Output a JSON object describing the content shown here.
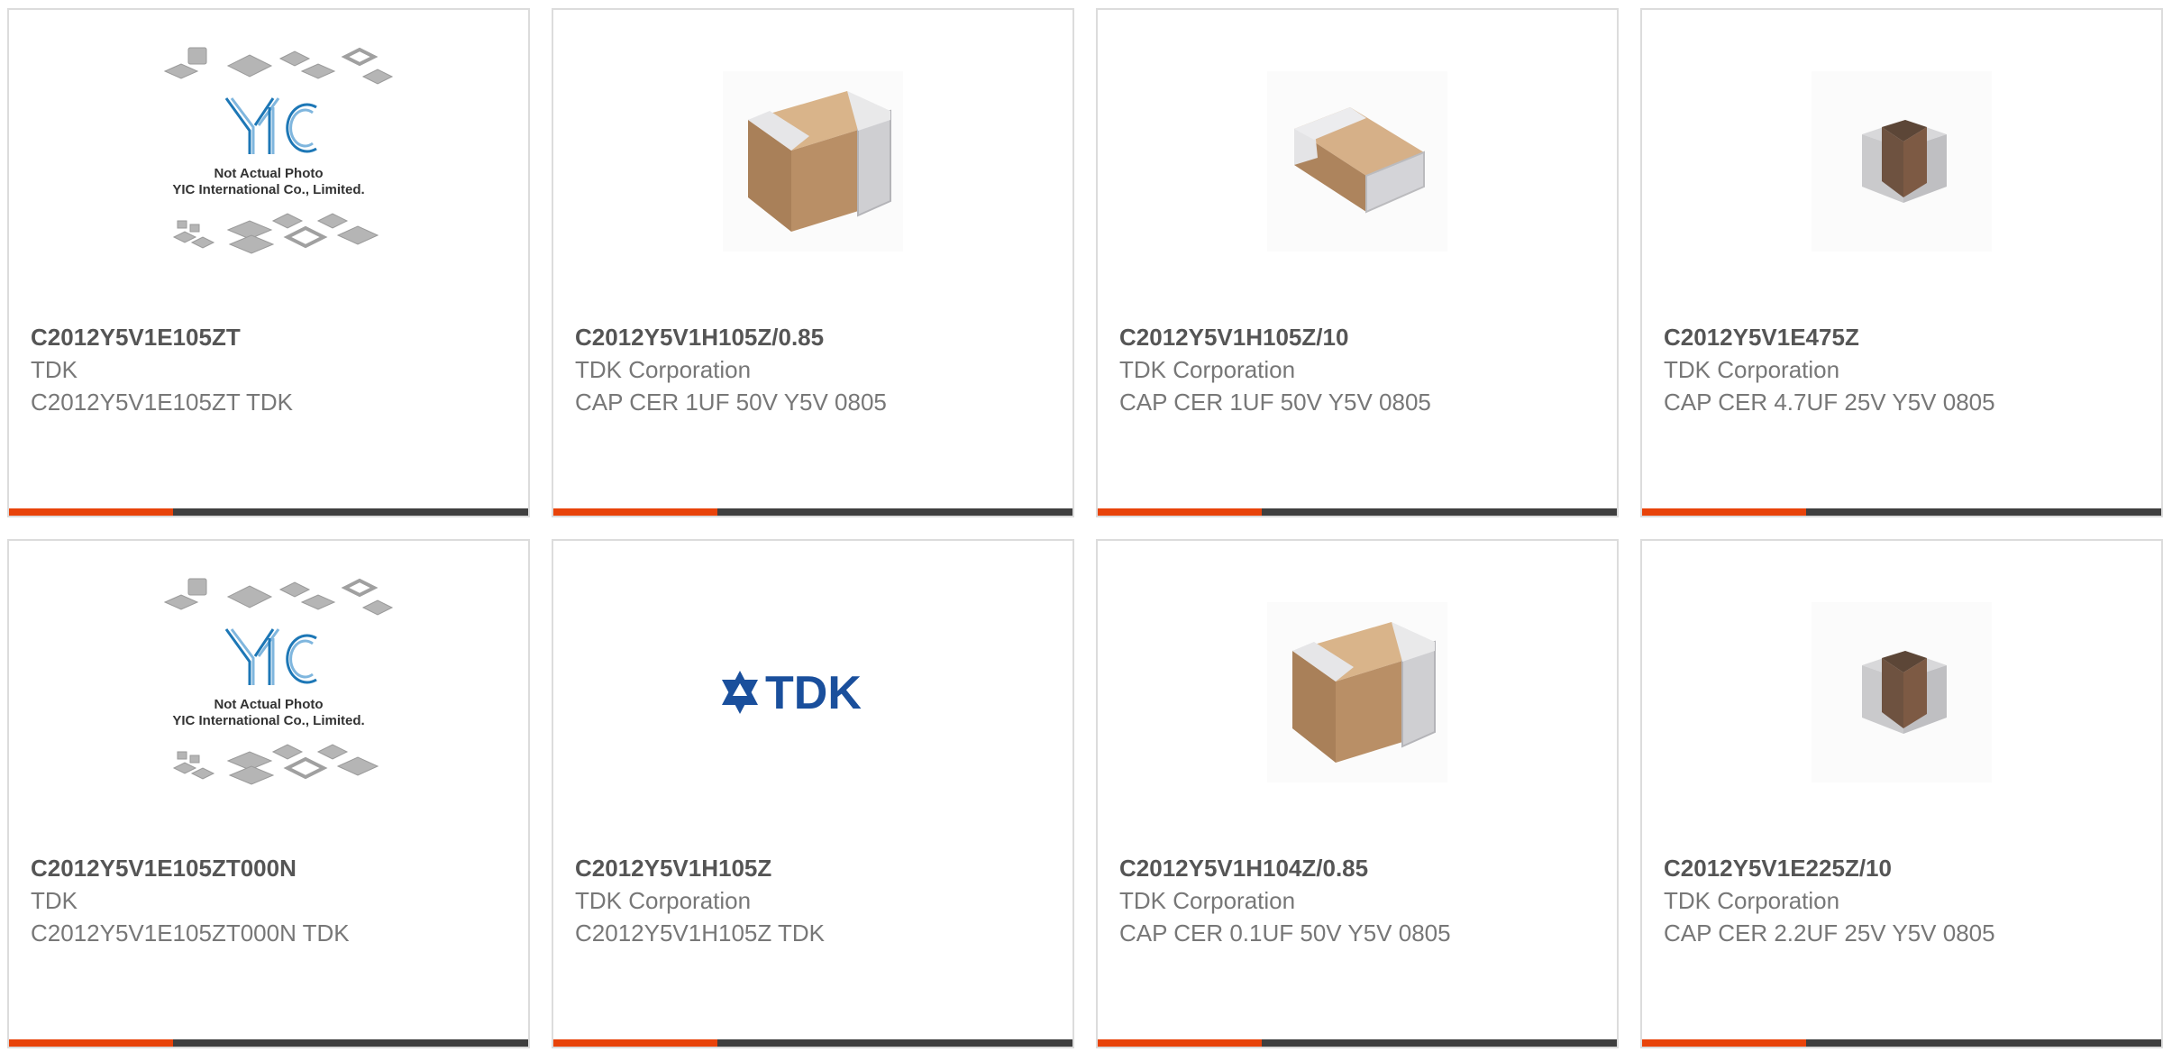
{
  "colors": {
    "accent": "#e8430a",
    "bar_dark": "#3f3f3f",
    "border": "#dcdcdc",
    "tdk_blue": "#1a4f9c",
    "yic_blue": "#1d77b6"
  },
  "products": [
    {
      "part_number": "C2012Y5V1E105ZT",
      "manufacturer": "TDK",
      "description": "C2012Y5V1E105ZT TDK",
      "image": "yic-placeholder",
      "image_text": [
        "Not Actual Photo",
        "YIC International Co., Limited."
      ]
    },
    {
      "part_number": "C2012Y5V1H105Z/0.85",
      "manufacturer": "TDK Corporation",
      "description": "CAP CER 1UF 50V Y5V 0805",
      "image": "chip-capacitor-large"
    },
    {
      "part_number": "C2012Y5V1H105Z/10",
      "manufacturer": "TDK Corporation",
      "description": "CAP CER 1UF 50V Y5V 0805",
      "image": "chip-capacitor-medium"
    },
    {
      "part_number": "C2012Y5V1E475Z",
      "manufacturer": "TDK Corporation",
      "description": "CAP CER 4.7UF 25V Y5V 0805",
      "image": "chip-capacitor-small"
    },
    {
      "part_number": "C2012Y5V1E105ZT000N",
      "manufacturer": "TDK",
      "description": "C2012Y5V1E105ZT000N TDK",
      "image": "yic-placeholder",
      "image_text": [
        "Not Actual Photo",
        "YIC International Co., Limited."
      ]
    },
    {
      "part_number": "C2012Y5V1H105Z",
      "manufacturer": "TDK Corporation",
      "description": "C2012Y5V1H105Z TDK",
      "image": "tdk-logo",
      "image_text": [
        "TDK"
      ]
    },
    {
      "part_number": "C2012Y5V1H104Z/0.85",
      "manufacturer": "TDK Corporation",
      "description": "CAP CER 0.1UF 50V Y5V 0805",
      "image": "chip-capacitor-large"
    },
    {
      "part_number": "C2012Y5V1E225Z/10",
      "manufacturer": "TDK Corporation",
      "description": "CAP CER 2.2UF 25V Y5V 0805",
      "image": "chip-capacitor-small"
    }
  ]
}
